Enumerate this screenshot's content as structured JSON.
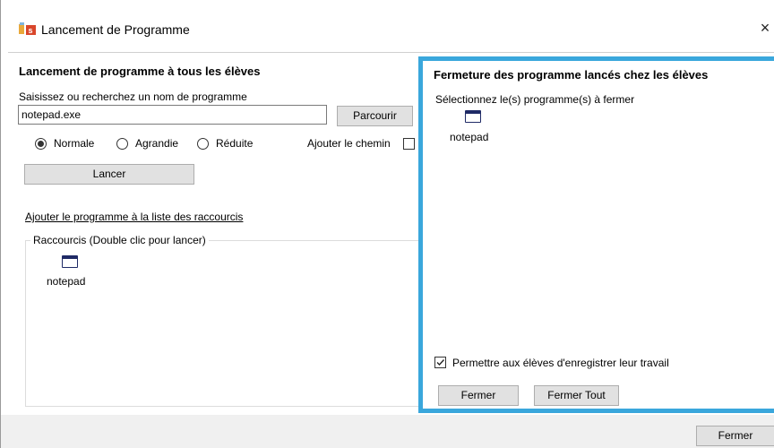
{
  "window": {
    "title": "Lancement de Programme",
    "close_symbol": "×",
    "accent_color": "#3aa7dc"
  },
  "left": {
    "title": "Lancement de programme à tous les élèves",
    "prompt": "Saisissez ou recherchez un nom de programme",
    "program_value": "notepad.exe",
    "browse_label": "Parcourir",
    "radios": [
      {
        "label": "Normale",
        "checked": true
      },
      {
        "label": "Agrandie",
        "checked": false
      },
      {
        "label": "Réduite",
        "checked": false
      }
    ],
    "add_path_label": "Ajouter le chemin",
    "launch_label": "Lancer",
    "add_shortcut_link": "Ajouter le programme à la liste des raccourcis",
    "shortcuts_title": "Raccourcis (Double clic pour lancer)",
    "shortcuts": [
      {
        "name": "notepad",
        "icon": "window-icon"
      }
    ]
  },
  "right": {
    "title": "Fermeture des programme lancés chez les élèves",
    "prompt": "Sélectionnez le(s) programme(s) à fermer",
    "programs": [
      {
        "name": "notepad",
        "icon": "window-icon"
      }
    ],
    "allow_save_label": "Permettre aux élèves d'enregistrer leur travail",
    "allow_save_checked": true,
    "close_label": "Fermer",
    "close_all_label": "Fermer Tout"
  },
  "footer": {
    "close_label": "Fermer"
  }
}
